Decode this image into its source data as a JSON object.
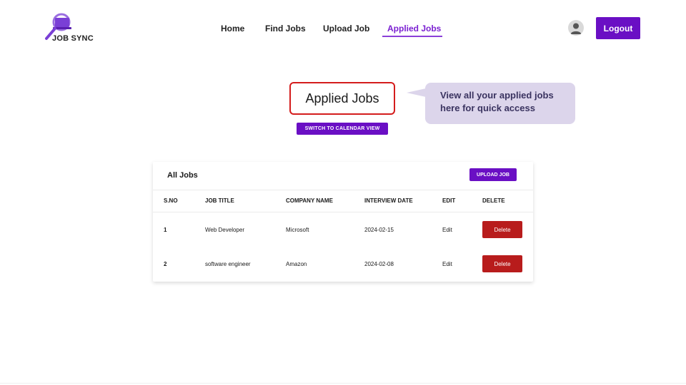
{
  "brand": {
    "logo_text": "JOB SYNC"
  },
  "nav": {
    "items": [
      {
        "label": "Home",
        "active": false
      },
      {
        "label": "Find Jobs",
        "active": false
      },
      {
        "label": "Upload Job",
        "active": false
      },
      {
        "label": "Applied Jobs",
        "active": true
      }
    ]
  },
  "header": {
    "logout_label": "Logout",
    "avatar_icon": "user-icon"
  },
  "page": {
    "title": "Applied Jobs",
    "tooltip": "View all your applied jobs here for quick access",
    "calendar_button": "SWITCH TO CALENDAR VIEW"
  },
  "table": {
    "title": "All Jobs",
    "upload_button": "UPLOAD JOB",
    "columns": [
      "S.NO",
      "JOB TITLE",
      "COMPANY NAME",
      "INTERVIEW DATE",
      "EDIT",
      "DELETE"
    ],
    "rows": [
      {
        "sno": "1",
        "job_title": "Web Developer",
        "company": "Microsoft",
        "date": "2024-02-15",
        "edit": "Edit",
        "delete": "Delete"
      },
      {
        "sno": "2",
        "job_title": "software engineer",
        "company": "Amazon",
        "date": "2024-02-08",
        "edit": "Edit",
        "delete": "Delete"
      }
    ]
  },
  "colors": {
    "accent": "#6a0fc4",
    "active_nav": "#7a1fd1",
    "delete": "#b81c1c",
    "tooltip_bg": "#dcd5eb",
    "title_border": "#d41c1c"
  }
}
